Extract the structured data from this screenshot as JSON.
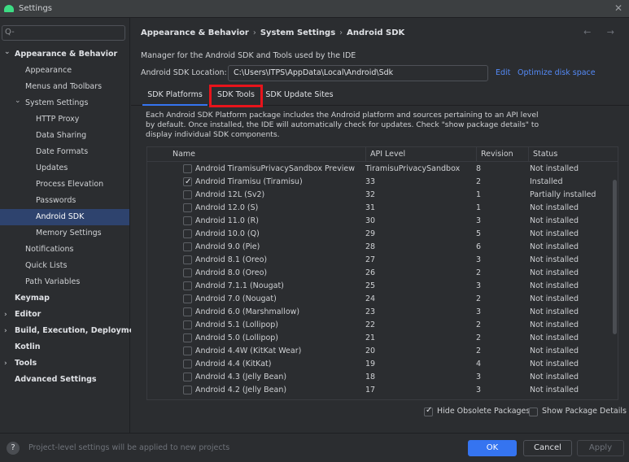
{
  "window": {
    "title": "Settings",
    "close": "✕"
  },
  "sidebar": {
    "search_placeholder": "Q-",
    "items": [
      {
        "label": "Appearance & Behavior",
        "bold": true,
        "expanded": true
      },
      {
        "label": "Appearance"
      },
      {
        "label": "Menus and Toolbars"
      },
      {
        "label": "System Settings",
        "expanded": true
      },
      {
        "label": "HTTP Proxy"
      },
      {
        "label": "Data Sharing"
      },
      {
        "label": "Date Formats"
      },
      {
        "label": "Updates"
      },
      {
        "label": "Process Elevation"
      },
      {
        "label": "Passwords"
      },
      {
        "label": "Android SDK",
        "selected": true
      },
      {
        "label": "Memory Settings"
      },
      {
        "label": "Notifications"
      },
      {
        "label": "Quick Lists"
      },
      {
        "label": "Path Variables"
      },
      {
        "label": "Keymap",
        "bold": true
      },
      {
        "label": "Editor",
        "bold": true,
        "collapsed": true
      },
      {
        "label": "Build, Execution, Deployment",
        "bold": true,
        "collapsed": true
      },
      {
        "label": "Kotlin",
        "bold": true
      },
      {
        "label": "Tools",
        "bold": true,
        "collapsed": true
      },
      {
        "label": "Advanced Settings",
        "bold": true
      }
    ]
  },
  "breadcrumb": [
    "Appearance & Behavior",
    "System Settings",
    "Android SDK"
  ],
  "nav_arrows": "← →",
  "description": "Manager for the Android SDK and Tools used by the IDE",
  "sdk_location": {
    "label": "Android SDK Location:",
    "value": "C:\\Users\\ITPS\\AppData\\Local\\Android\\Sdk",
    "edit": "Edit",
    "optimize": "Optimize disk space"
  },
  "tabs": [
    {
      "label": "SDK Platforms",
      "active": true
    },
    {
      "label": "SDK Tools",
      "highlighted": true
    },
    {
      "label": "SDK Update Sites"
    }
  ],
  "package_description": "Each Android SDK Platform package includes the Android platform and sources pertaining to an API level by default. Once installed, the IDE will automatically check for updates. Check \"show package details\" to display individual SDK components.",
  "table": {
    "headers": [
      "Name",
      "API Level",
      "Revision",
      "Status"
    ],
    "rows": [
      {
        "checked": false,
        "name": "Android TiramisuPrivacySandbox Preview",
        "api": "TiramisuPrivacySandbox",
        "rev": "8",
        "status": "Not installed"
      },
      {
        "checked": true,
        "name": "Android Tiramisu (Tiramisu)",
        "api": "33",
        "rev": "2",
        "status": "Installed"
      },
      {
        "checked": false,
        "name": "Android 12L (Sv2)",
        "api": "32",
        "rev": "1",
        "status": "Partially installed"
      },
      {
        "checked": false,
        "name": "Android 12.0 (S)",
        "api": "31",
        "rev": "1",
        "status": "Not installed"
      },
      {
        "checked": false,
        "name": "Android 11.0 (R)",
        "api": "30",
        "rev": "3",
        "status": "Not installed"
      },
      {
        "checked": false,
        "name": "Android 10.0 (Q)",
        "api": "29",
        "rev": "5",
        "status": "Not installed"
      },
      {
        "checked": false,
        "name": "Android 9.0 (Pie)",
        "api": "28",
        "rev": "6",
        "status": "Not installed"
      },
      {
        "checked": false,
        "name": "Android 8.1 (Oreo)",
        "api": "27",
        "rev": "3",
        "status": "Not installed"
      },
      {
        "checked": false,
        "name": "Android 8.0 (Oreo)",
        "api": "26",
        "rev": "2",
        "status": "Not installed"
      },
      {
        "checked": false,
        "name": "Android 7.1.1 (Nougat)",
        "api": "25",
        "rev": "3",
        "status": "Not installed"
      },
      {
        "checked": false,
        "name": "Android 7.0 (Nougat)",
        "api": "24",
        "rev": "2",
        "status": "Not installed"
      },
      {
        "checked": false,
        "name": "Android 6.0 (Marshmallow)",
        "api": "23",
        "rev": "3",
        "status": "Not installed"
      },
      {
        "checked": false,
        "name": "Android 5.1 (Lollipop)",
        "api": "22",
        "rev": "2",
        "status": "Not installed"
      },
      {
        "checked": false,
        "name": "Android 5.0 (Lollipop)",
        "api": "21",
        "rev": "2",
        "status": "Not installed"
      },
      {
        "checked": false,
        "name": "Android 4.4W (KitKat Wear)",
        "api": "20",
        "rev": "2",
        "status": "Not installed"
      },
      {
        "checked": false,
        "name": "Android 4.4 (KitKat)",
        "api": "19",
        "rev": "4",
        "status": "Not installed"
      },
      {
        "checked": false,
        "name": "Android 4.3 (Jelly Bean)",
        "api": "18",
        "rev": "3",
        "status": "Not installed"
      },
      {
        "checked": false,
        "name": "Android 4.2 (Jelly Bean)",
        "api": "17",
        "rev": "3",
        "status": "Not installed"
      }
    ]
  },
  "options": {
    "hide_obsolete": {
      "label": "Hide Obsolete Packages",
      "checked": true
    },
    "show_details": {
      "label": "Show Package Details",
      "checked": false
    }
  },
  "footer": {
    "help": "?",
    "note": "Project-level settings will be applied to new projects",
    "ok": "OK",
    "cancel": "Cancel",
    "apply": "Apply"
  },
  "colors": {
    "accent": "#3574f0",
    "selection": "#2e436e",
    "highlight_box": "#e8141b",
    "link": "#548af7",
    "android_icon": "#3ddc84"
  }
}
